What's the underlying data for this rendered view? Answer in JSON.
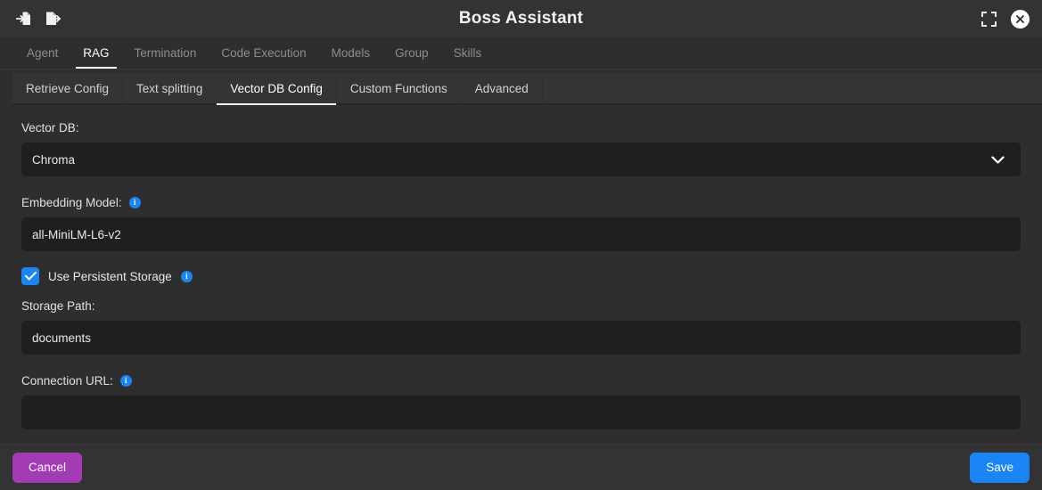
{
  "window": {
    "title": "Boss Assistant",
    "import_icon": "import-document-icon",
    "export_icon": "export-document-icon",
    "fullscreen_icon": "fullscreen-icon",
    "close_icon": "close-icon"
  },
  "main_tabs": [
    {
      "label": "Agent",
      "active": false
    },
    {
      "label": "RAG",
      "active": true
    },
    {
      "label": "Termination",
      "active": false
    },
    {
      "label": "Code Execution",
      "active": false
    },
    {
      "label": "Models",
      "active": false
    },
    {
      "label": "Group",
      "active": false
    },
    {
      "label": "Skills",
      "active": false
    }
  ],
  "sub_tabs": [
    {
      "label": "Retrieve Config",
      "active": false
    },
    {
      "label": "Text splitting",
      "active": false
    },
    {
      "label": "Vector DB Config",
      "active": true
    },
    {
      "label": "Custom Functions",
      "active": false
    },
    {
      "label": "Advanced",
      "active": false
    }
  ],
  "form": {
    "vector_db": {
      "label": "Vector DB:",
      "value": "Chroma",
      "chevron_icon": "chevron-down-icon"
    },
    "embedding_model": {
      "label": "Embedding Model:",
      "value": "all-MiniLM-L6-v2",
      "placeholder": "",
      "info_icon": "info-icon"
    },
    "persistent_storage": {
      "label": "Use Persistent Storage",
      "checked": true,
      "check_icon": "checkmark-icon",
      "info_icon": "info-icon"
    },
    "storage_path": {
      "label": "Storage Path:",
      "value": "documents",
      "placeholder": ""
    },
    "connection_url": {
      "label": "Connection URL:",
      "value": "",
      "placeholder": "",
      "info_icon": "info-icon"
    }
  },
  "footer": {
    "cancel_label": "Cancel",
    "save_label": "Save"
  },
  "colors": {
    "accent_blue": "#1a85f5",
    "cancel_purple": "#a33bb5",
    "page_bg": "#2e2e2e",
    "input_bg": "#1f1f1f",
    "bar_bg": "#333333"
  }
}
